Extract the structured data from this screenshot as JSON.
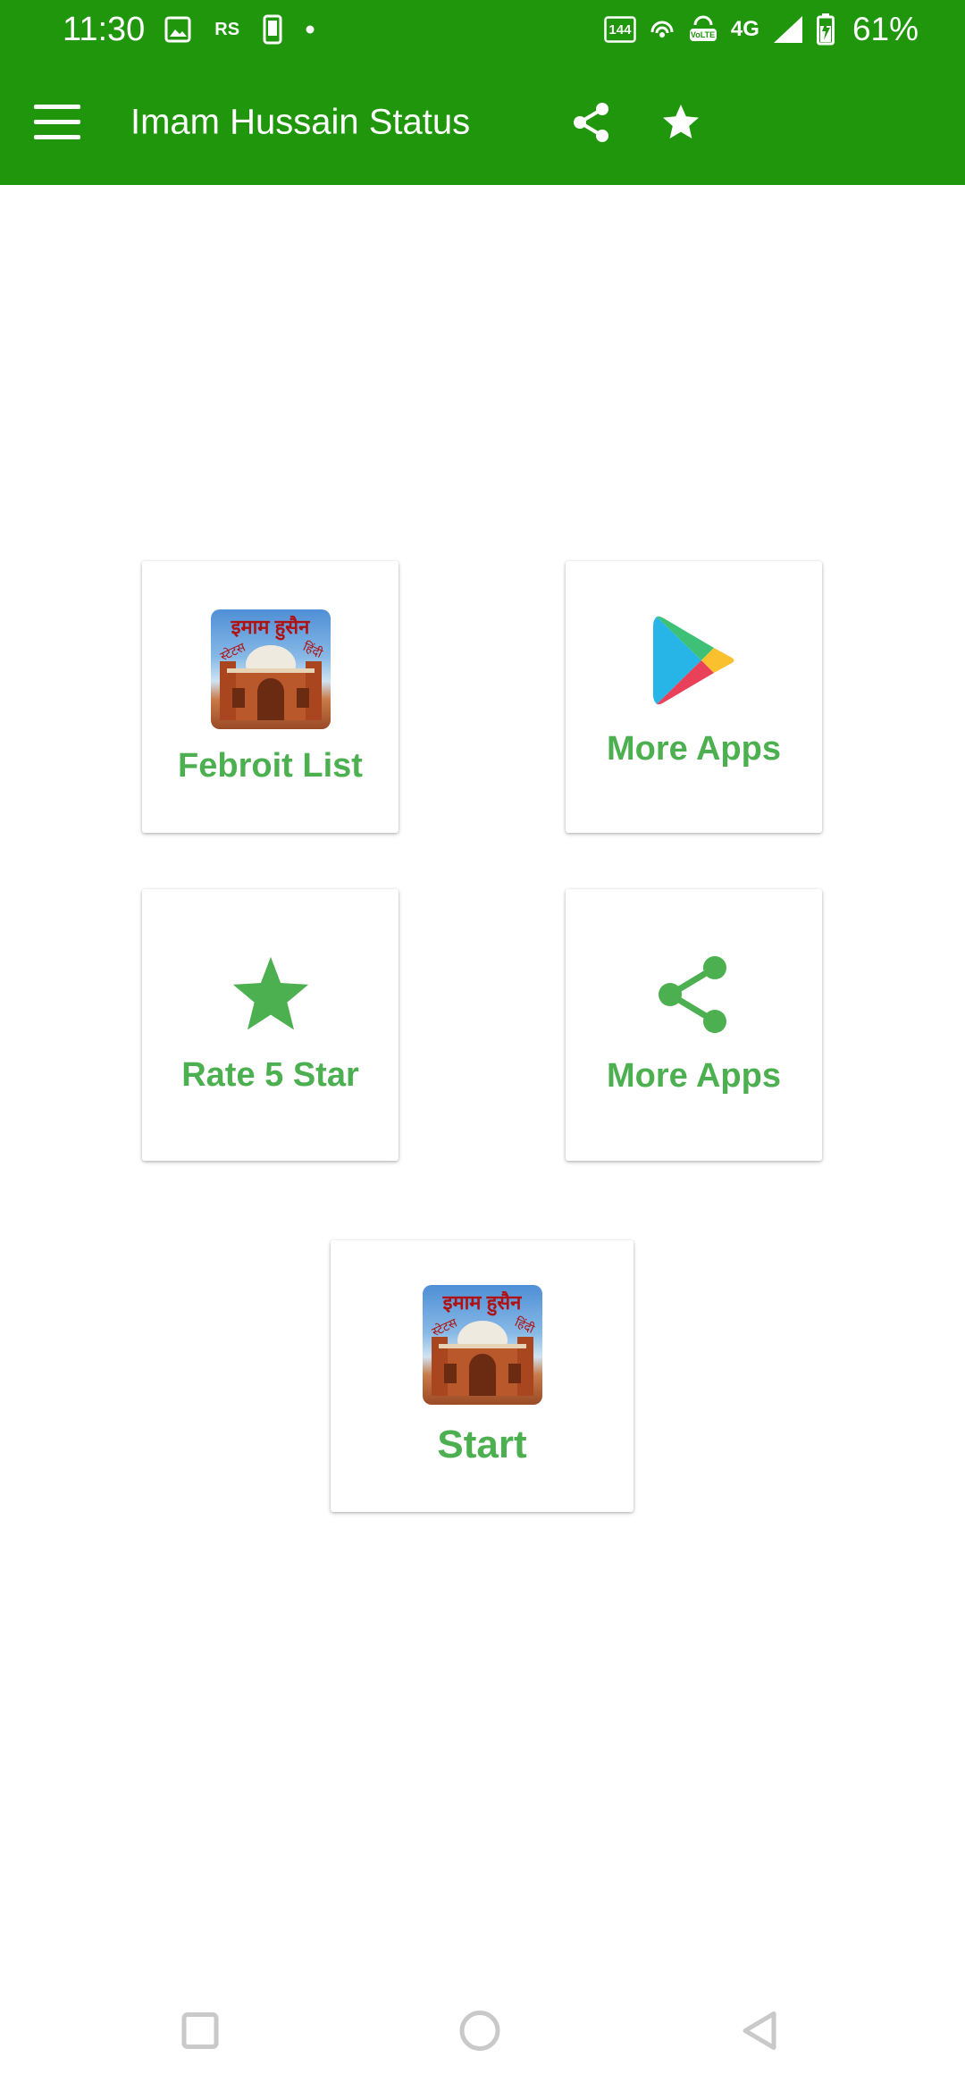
{
  "status_bar": {
    "time": "11:30",
    "rs_badge": "RS",
    "refresh_rate": "144",
    "volte": "VoLTE",
    "network": "4G",
    "battery": "61%"
  },
  "toolbar": {
    "title": "Imam Hussain Status"
  },
  "cards": {
    "favorite": {
      "label": "Febroit List",
      "icon": "app-thumbnail"
    },
    "more_apps_play": {
      "label": "More Apps",
      "icon": "play-store-icon"
    },
    "rate": {
      "label": "Rate 5 Star",
      "icon": "star-icon"
    },
    "more_apps_share": {
      "label": "More Apps",
      "icon": "share-icon"
    },
    "start": {
      "label": "Start",
      "icon": "app-thumbnail"
    }
  },
  "thumbnail": {
    "caption_top": "इमाम हुसैन",
    "caption_left": "स्टेटस",
    "caption_right": "हिंदी"
  },
  "colors": {
    "appbar": "#1f960c",
    "accent": "#4caf50",
    "background": "#ffffff"
  }
}
